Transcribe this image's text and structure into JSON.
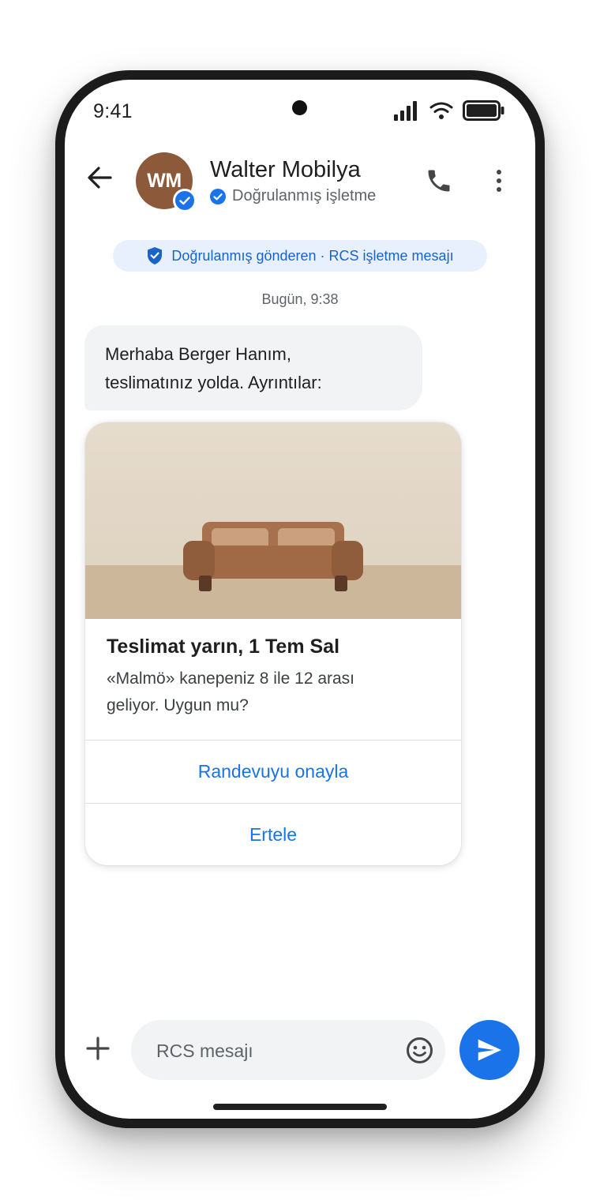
{
  "status_bar": {
    "time": "9:41"
  },
  "header": {
    "avatar_initials": "WM",
    "contact_name": "Walter Mobilya",
    "verified_text": "Doğrulanmış işletme",
    "icons": [
      "back-arrow-icon",
      "verified-check-icon",
      "phone-icon",
      "more-vert-icon"
    ]
  },
  "conversation": {
    "sender_notice": "Doğrulanmış gönderen · RCS işletme mesajı",
    "date_label": "Bugün, 9:38",
    "message": {
      "line1": "Merhaba Berger Hanım,",
      "line2": "teslimatınız yolda. Ayrıntılar:"
    },
    "rich_card": {
      "image": "sofa-illustration",
      "title": "Teslimat yarın, 1 Tem Sal",
      "description_line1": "«Malmö» kanepeniz 8 ile 12 arası",
      "description_line2": "geliyor. Uygun mu?",
      "actions": [
        "Randevuyu onayla",
        "Ertele"
      ]
    }
  },
  "composer": {
    "placeholder": "RCS mesajı",
    "icons": [
      "add-icon",
      "emoji-icon",
      "send-icon"
    ]
  },
  "colors": {
    "accent": "#1a73e8",
    "avatar": "#8c5a3a",
    "pill_background": "#e8f0fe"
  }
}
